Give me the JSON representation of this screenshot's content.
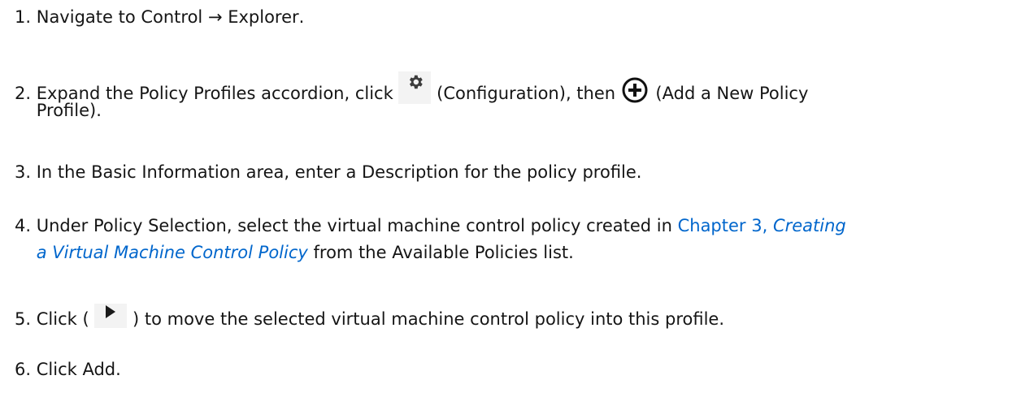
{
  "steps": [
    {
      "num": "1.",
      "t1": "Navigate to ",
      "b1": "Control → Explorer",
      "t2": "."
    },
    {
      "num": "2.",
      "t1": "Expand the ",
      "b1": "Policy Profiles",
      "t2": " accordion, click ",
      "t3": " (",
      "b2": "Configuration",
      "t4": "), then ",
      "t5": " (",
      "b3": "Add a New Policy",
      "b4": "Profile",
      "t6": ")."
    },
    {
      "num": "3.",
      "t1": "In the ",
      "b1": "Basic Information",
      "t2": " area, enter a ",
      "b2": "Description",
      "t3": " for the policy profile."
    },
    {
      "num": "4.",
      "t1": "Under ",
      "b1": "Policy Selection",
      "t2": ", select the virtual machine control policy created in ",
      "link1": "Chapter 3, ",
      "link2": "Creating",
      "link3": "a Virtual Machine Control Policy",
      "t3": " from the ",
      "b2": "Available Policies",
      "t4": " list."
    },
    {
      "num": "5.",
      "t1": "Click ( ",
      "t2": " ) to move the selected virtual machine control policy into this profile."
    },
    {
      "num": "6.",
      "t1": "Click ",
      "b1": "Add",
      "t2": "."
    }
  ],
  "icons": {
    "configuration": "gear-icon",
    "add_policy_profile": "plus-circle-icon",
    "move_right": "triangle-right-icon"
  }
}
